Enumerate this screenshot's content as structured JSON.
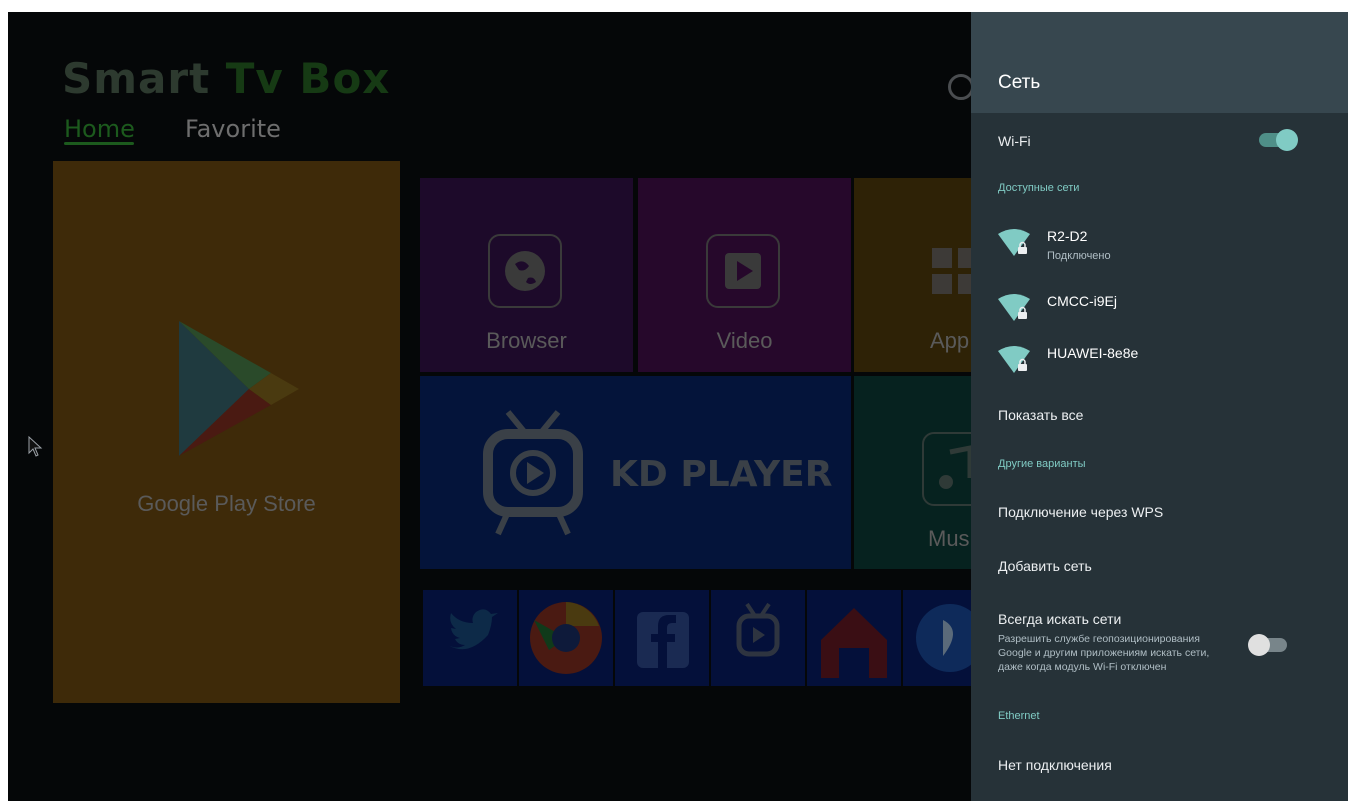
{
  "launcher": {
    "brand_part1": "Smart",
    "brand_part2": "Tv Box",
    "tabs": [
      "Home",
      "Favorite"
    ],
    "tiles": {
      "play": "Google Play Store",
      "browser": "Browser",
      "video": "Video",
      "apps": "App",
      "kd": "KD PLAYER",
      "music": "Mus"
    },
    "app_row": [
      "twitter-icon",
      "chrome-icon",
      "facebook-icon",
      "tv-player-icon",
      "home-icon",
      "media-player-icon"
    ]
  },
  "panel": {
    "title": "Сеть",
    "wifi_label": "Wi-Fi",
    "wifi_enabled": true,
    "available_label": "Доступные сети",
    "networks": [
      {
        "name": "R2-D2",
        "status": "Подключено"
      },
      {
        "name": "CMCC-i9Ej",
        "status": ""
      },
      {
        "name": "HUAWEI-8e8e",
        "status": ""
      }
    ],
    "show_all": "Показать все",
    "other_label": "Другие варианты",
    "wps": "Подключение через WPS",
    "add_network": "Добавить сеть",
    "always_scan_title": "Всегда искать сети",
    "always_scan_desc": "Разрешить службе геопозиционирования Google и другим приложениям искать сети, даже когда модуль Wi-Fi отключен",
    "always_scan_enabled": false,
    "ethernet_label": "Ethernet",
    "ethernet_status": "Нет подключения"
  },
  "colors": {
    "panel_bg": "#263238",
    "panel_header": "#37474f",
    "accent": "#80cbc4"
  }
}
